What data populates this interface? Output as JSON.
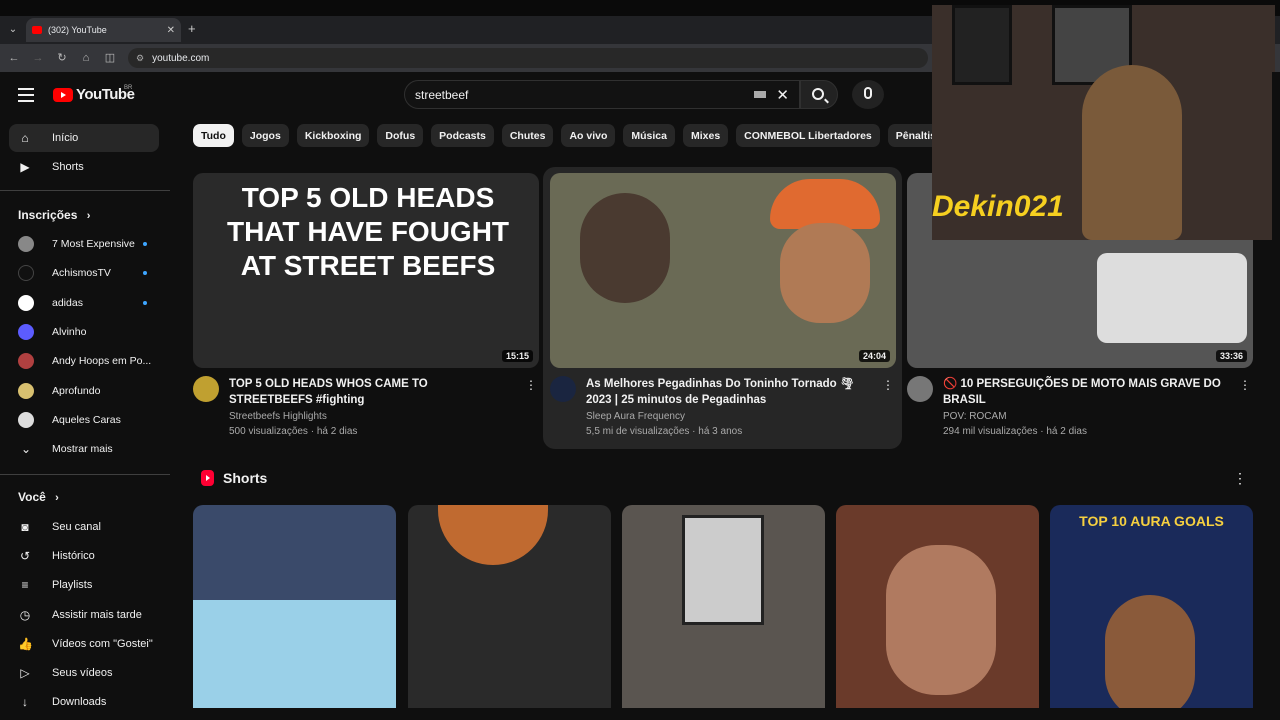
{
  "browser": {
    "tab_title": "(302) YouTube",
    "new_tab": "+",
    "url": "youtube.com"
  },
  "header": {
    "logo_text": "YouTube",
    "country": "BR",
    "search_query": "streetbeef"
  },
  "sidebar": {
    "main": [
      {
        "label": "Início",
        "icon": "home-icon"
      },
      {
        "label": "Shorts",
        "icon": "shorts-icon"
      }
    ],
    "subscriptions_title": "Inscrições",
    "subscriptions": [
      {
        "label": "7 Most Expensive",
        "dot": true,
        "color": "#888888"
      },
      {
        "label": "AchismosTV",
        "dot": true,
        "color": "#111111"
      },
      {
        "label": "adidas",
        "dot": true,
        "color": "#ffffff"
      },
      {
        "label": "Alvinho",
        "dot": false,
        "color": "#5c5cff"
      },
      {
        "label": "Andy Hoops em Po...",
        "dot": false,
        "color": "#b04040"
      },
      {
        "label": "Aprofundo",
        "dot": false,
        "color": "#d8c070"
      },
      {
        "label": "Aqueles Caras",
        "dot": false,
        "color": "#dddddd"
      }
    ],
    "show_more": "Mostrar mais",
    "you_title": "Você",
    "you_items": [
      {
        "label": "Seu canal",
        "icon": "channel-icon"
      },
      {
        "label": "Histórico",
        "icon": "history-icon"
      },
      {
        "label": "Playlists",
        "icon": "playlists-icon"
      },
      {
        "label": "Assistir mais tarde",
        "icon": "watch-later-icon"
      },
      {
        "label": "Vídeos com \"Gostei\"",
        "icon": "like-icon"
      },
      {
        "label": "Seus vídeos",
        "icon": "your-videos-icon"
      },
      {
        "label": "Downloads",
        "icon": "downloads-icon"
      }
    ]
  },
  "chips": [
    "Tudo",
    "Jogos",
    "Kickboxing",
    "Dofus",
    "Podcasts",
    "Chutes",
    "Ao vivo",
    "Música",
    "Mixes",
    "CONMEBOL Libertadores",
    "Pênaltis"
  ],
  "videos": [
    {
      "title": "TOP 5 OLD HEADS WHOS CAME TO STREETBEEFS #fighting",
      "channel": "Streetbeefs Highlights",
      "stats": "500 visualizações · há 2 dias",
      "duration": "15:15",
      "thumb_text": "TOP 5 OLD HEADS THAT HAVE FOUGHT AT STREET BEEFS"
    },
    {
      "title": "As Melhores Pegadinhas Do Toninho Tornado 🌪 2023 | 25 minutos de Pegadinhas",
      "channel": "Sleep Aura Frequency",
      "stats": "5,5 mi de visualizações · há 3 anos",
      "duration": "24:04"
    },
    {
      "title": "🚫 10 PERSEGUIÇÕES DE MOTO MAIS GRAVE DO BRASIL",
      "channel": "POV: ROCAM",
      "stats": "294 mil visualizações · há 2 dias",
      "duration": "33:36"
    }
  ],
  "shorts": {
    "title": "Shorts",
    "items": [
      {
        "color": "#3a4a6a"
      },
      {
        "color": "#2a2a2a"
      },
      {
        "color": "#5a5550"
      },
      {
        "color": "#6a3a2a"
      },
      {
        "color": "#1a2a5a",
        "text": "TOP 10 AURA GOALS"
      }
    ]
  },
  "webcam": {
    "overlay_text": "Dekin021"
  }
}
